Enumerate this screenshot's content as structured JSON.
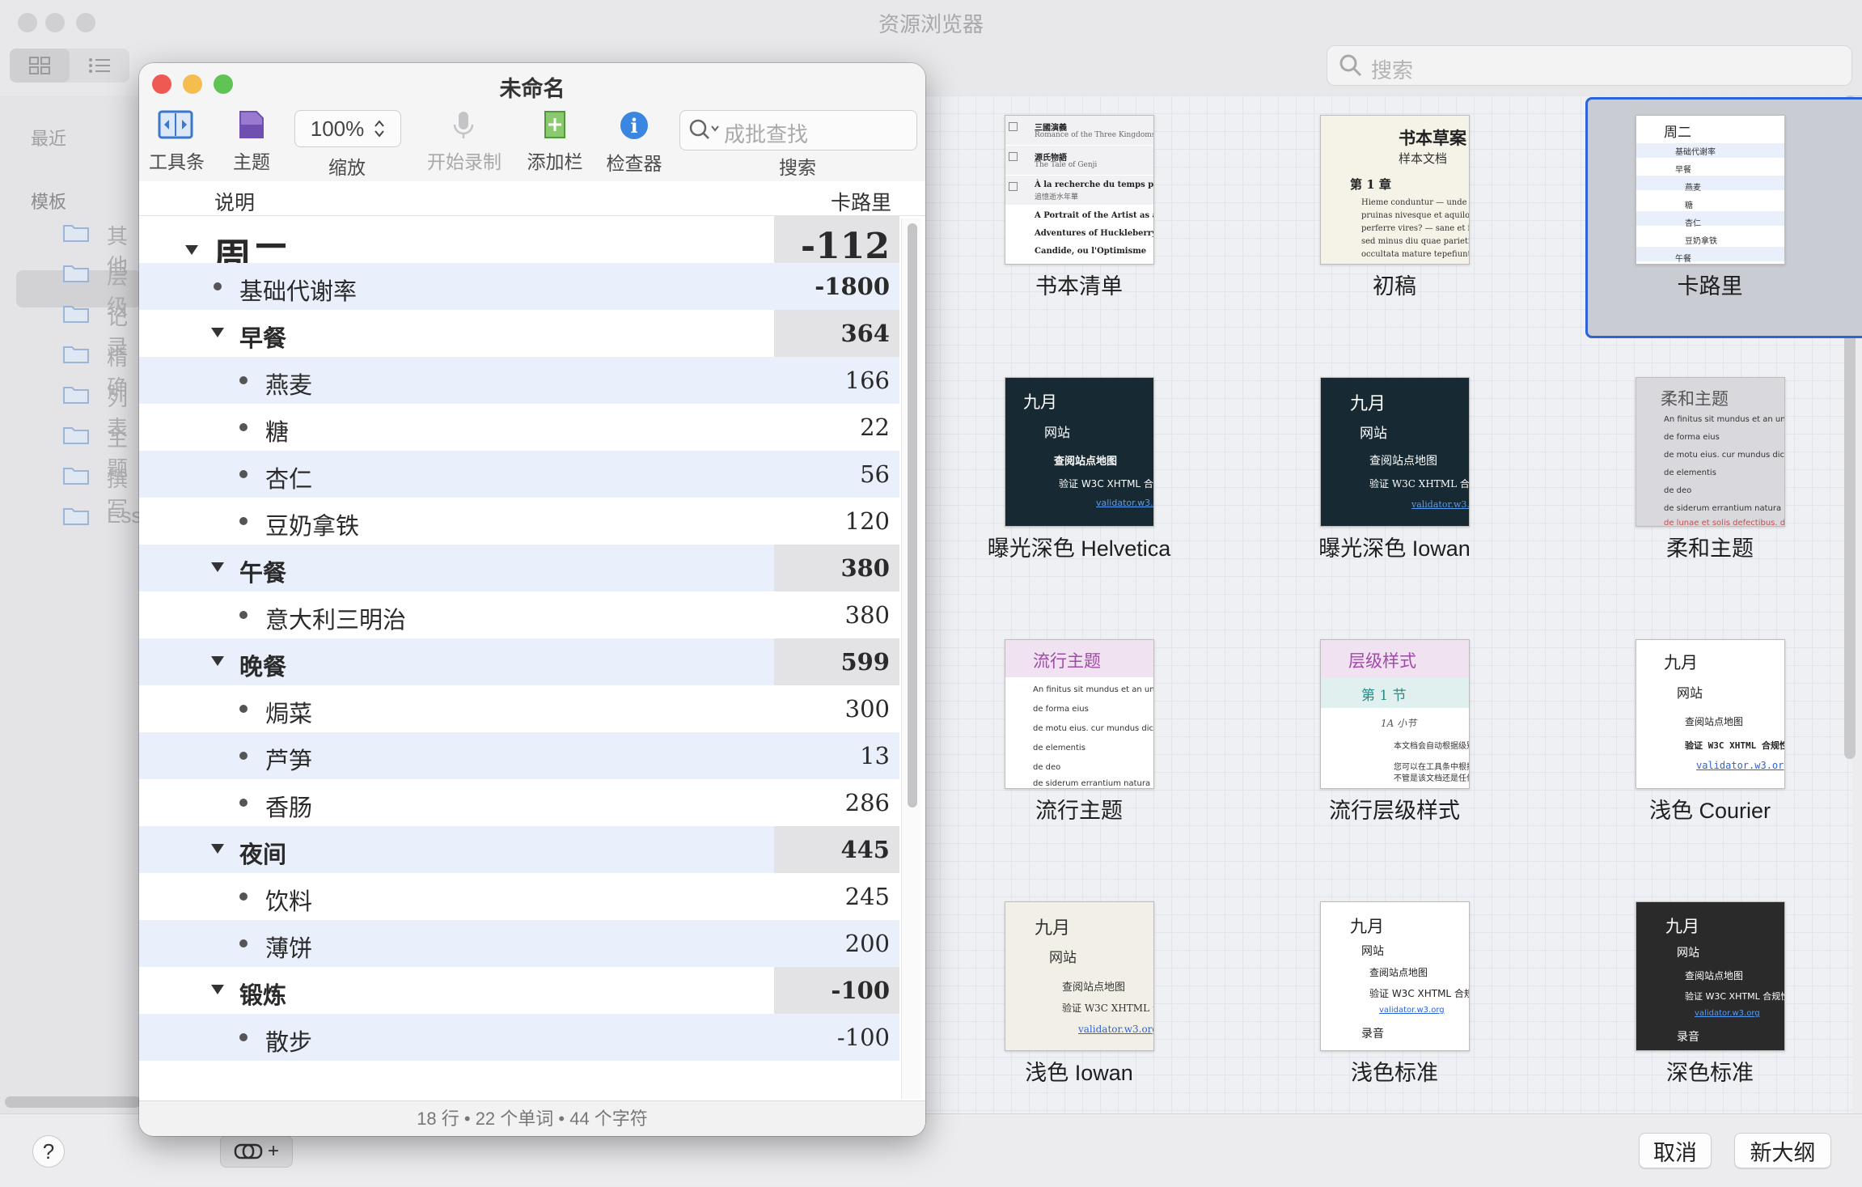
{
  "browser": {
    "title": "资源浏览器",
    "search_placeholder": "搜索",
    "sidebar": {
      "recent_label": "最近",
      "templates_label": "模板",
      "folders": [
        "其他",
        "层级",
        "记录",
        "精确",
        "列表",
        "主题",
        "撰写",
        "Ess"
      ]
    },
    "templates": [
      {
        "label": "书本清单"
      },
      {
        "label": "初稿"
      },
      {
        "label": "卡路里"
      },
      {
        "label": "曝光深色 Helvetica"
      },
      {
        "label": "曝光深色 Iowan"
      },
      {
        "label": "柔和主题"
      },
      {
        "label": "流行主题"
      },
      {
        "label": "流行层级样式"
      },
      {
        "label": "浅色 Courier"
      },
      {
        "label": "浅色 Iowan"
      },
      {
        "label": "浅色标准"
      },
      {
        "label": "深色标准"
      }
    ],
    "cancel_label": "取消",
    "new_label": "新大纲",
    "help_label": "?",
    "attach_plus": "+"
  },
  "thumbs": {
    "books": {
      "rows": [
        {
          "t": "三國演義",
          "s": "Romance of the Three Kingdoms"
        },
        {
          "t": "源氏物語",
          "s": "The Tale of Genji"
        },
        {
          "t": "À la recherche du temps perdu",
          "s": "追憶逝水年華"
        },
        {
          "t": "A Portrait of the Artist as a Young Man",
          "s": ""
        },
        {
          "t": "Adventures of Huckleberry Finn",
          "s": ""
        },
        {
          "t": "Candide, ou l'Optimisme",
          "s": ""
        }
      ]
    },
    "draft": {
      "title": "书本草案",
      "subtitle": "样本文档",
      "chapter": "第 1 章",
      "body": [
        "Hieme conduntur — unde er",
        "pruinas nivesque et aquilonu",
        "perferre vires? — sane et inse",
        "sed minus diu quae parietibu",
        "occultata mature tepefiunt. c"
      ]
    },
    "calorie": {
      "items": [
        "周二",
        "基础代谢率",
        "早餐",
        "燕麦",
        "糖",
        "杏仁",
        "豆奶拿铁",
        "午餐"
      ]
    },
    "dark": {
      "items": [
        "九月",
        "网站",
        "查阅站点地图",
        "验证 W3C XHTML 合规性",
        "validator.w3.org",
        "录音"
      ]
    },
    "soft": {
      "title": "柔和主题",
      "items": [
        "An finitus sit mundus et an unu",
        "de forma eius",
        "de motu eius. cur mundus dica",
        "de elementis",
        "de deo",
        "de siderum errantium natura",
        "de lunae et solis defectibus. de"
      ]
    },
    "pop": {
      "title": "流行主题"
    },
    "pophier": {
      "title": "层级样式",
      "section": "第 1 节",
      "sub": "1A 小节",
      "items": [
        "本文档会自动根据级别来",
        "您可以在工具条中根据自",
        "不管是该文档还是任何 O"
      ]
    }
  },
  "doc": {
    "title": "未命名",
    "toolbar": {
      "toolbar_label": "工具条",
      "theme_label": "主题",
      "zoom_value": "100%",
      "zoom_label": "缩放",
      "record_label": "开始录制",
      "addcol_label": "添加栏",
      "inspector_label": "检查器",
      "search_label": "搜索",
      "search_placeholder": "成批查找"
    },
    "columns": {
      "desc": "说明",
      "calories": "卡路里"
    },
    "rows": [
      {
        "text": "周二",
        "value": "-112"
      },
      {
        "text": "基础代谢率",
        "value": "-1800"
      },
      {
        "text": "早餐",
        "value": "364"
      },
      {
        "text": "燕麦",
        "value": "166"
      },
      {
        "text": "糖",
        "value": "22"
      },
      {
        "text": "杏仁",
        "value": "56"
      },
      {
        "text": "豆奶拿铁",
        "value": "120"
      },
      {
        "text": "午餐",
        "value": "380"
      },
      {
        "text": "意大利三明治",
        "value": "380"
      },
      {
        "text": "晚餐",
        "value": "599"
      },
      {
        "text": "焗菜",
        "value": "300"
      },
      {
        "text": "芦笋",
        "value": "13"
      },
      {
        "text": "香肠",
        "value": "286"
      },
      {
        "text": "夜间",
        "value": "445"
      },
      {
        "text": "饮料",
        "value": "245"
      },
      {
        "text": "薄饼",
        "value": "200"
      },
      {
        "text": "锻炼",
        "value": "-100"
      },
      {
        "text": "散步",
        "value": "-100"
      }
    ],
    "status": "18 行 • 22 个单词 • 44 个字符"
  },
  "colors": {
    "accent": "#2d63d8",
    "close": "#ee5a52",
    "minimize": "#f5bd4f",
    "zoom": "#5fc454",
    "row_alt": "#e9f0fb"
  }
}
